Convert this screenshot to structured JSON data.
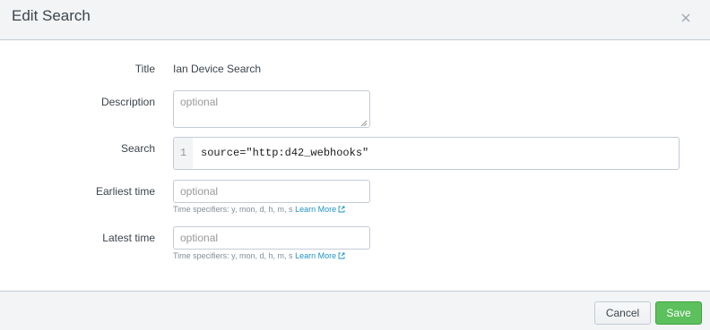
{
  "dialog": {
    "title": "Edit Search"
  },
  "form": {
    "title": {
      "label": "Title",
      "value": "Ian Device Search"
    },
    "description": {
      "label": "Description",
      "placeholder": "optional"
    },
    "search": {
      "label": "Search",
      "line_number": "1",
      "query": "source=\"http:d42_webhooks\""
    },
    "earliest_time": {
      "label": "Earliest time",
      "placeholder": "optional",
      "help_text": "Time specifiers: y, mon, d, h, m, s",
      "help_link": "Learn More"
    },
    "latest_time": {
      "label": "Latest time",
      "placeholder": "optional",
      "help_text": "Time specifiers: y, mon, d, h, m, s",
      "help_link": "Learn More"
    }
  },
  "footer": {
    "cancel_label": "Cancel",
    "save_label": "Save"
  },
  "icons": {
    "close": "close-icon",
    "external_link": "external-link-icon",
    "resize": "resize-grip-icon"
  },
  "colors": {
    "save_button": "#5cc05c",
    "link": "#1e93c6",
    "header_bg": "#f2f4f5"
  }
}
